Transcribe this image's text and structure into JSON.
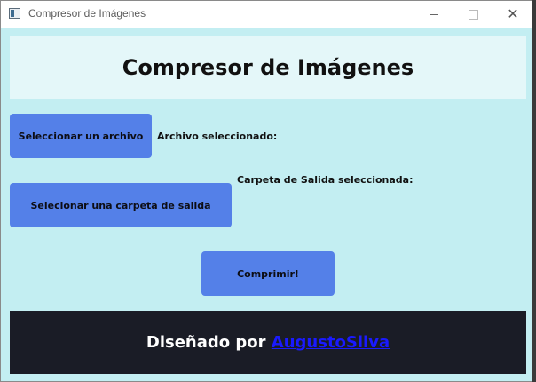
{
  "window": {
    "title": "Compresor de Imágenes"
  },
  "header": {
    "title": "Compresor de Imágenes"
  },
  "file_section": {
    "button_label": "Seleccionar un archivo",
    "status_label": "Archivo seleccionado:"
  },
  "folder_section": {
    "button_label": "Selecionar una carpeta de salida",
    "status_label": "Carpeta de Salida seleccionada:"
  },
  "compress": {
    "button_label": "Comprimir!"
  },
  "footer": {
    "prefix": "Diseñado por ",
    "author_link": "AugustoSilva"
  },
  "colors": {
    "background": "#c3eef2",
    "header_bg": "#e4f7f9",
    "button": "#5480e8",
    "footer_bg": "#1a1c26",
    "link": "#1a1aff"
  },
  "icons": {
    "app": "app-window-icon",
    "minimize": "minimize-icon",
    "maximize": "maximize-icon",
    "close": "close-icon"
  }
}
